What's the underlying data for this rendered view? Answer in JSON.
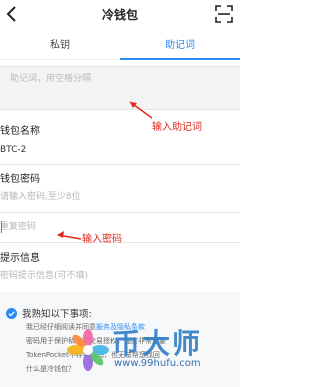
{
  "header": {
    "title": "冷钱包"
  },
  "tabs": [
    {
      "label": "私钥",
      "active": false
    },
    {
      "label": "助记词",
      "active": true
    }
  ],
  "mnemonic": {
    "placeholder": "助记词，用空格分隔"
  },
  "annotations": {
    "mnemonic_note": "输入助记词",
    "password_note": "输入密码"
  },
  "form": {
    "wallet_name_label": "钱包名称",
    "wallet_name_value": "BTC-2",
    "password_label": "钱包密码",
    "password_placeholder": "请输入密码,至少8位",
    "repeat_password_placeholder": "重复密码",
    "hint_label": "提示信息",
    "hint_placeholder": "密码提示信息(可不填)"
  },
  "agreement": {
    "title": "我熟知以下事项:",
    "checked": true,
    "note1_prefix": "我已经仔细阅读并同意",
    "note1_link": "服务及隐私条款",
    "note2": "密码用于保护私钥和交易授权，强度非常重要",
    "note3": "TokenPocket不存储密码，也无法帮您找回",
    "note4": "什么是冷钱包？"
  },
  "watermark": {
    "brand": "币大师",
    "url": "www.99hufu.com"
  },
  "colors": {
    "accent": "#2b8af8",
    "annotation_red": "#e0281f",
    "watermark_blue": "#2f7fc8"
  }
}
